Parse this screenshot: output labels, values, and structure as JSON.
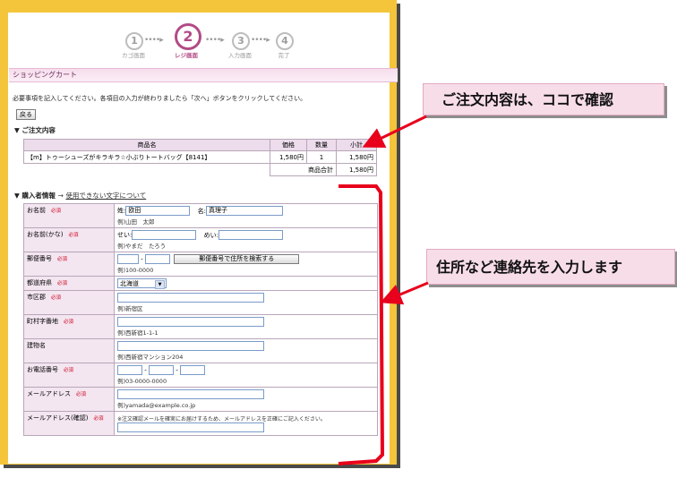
{
  "steps": [
    {
      "num": "①",
      "label": "カゴ画面",
      "active": false
    },
    {
      "num": "②",
      "label": "レジ画面",
      "active": true
    },
    {
      "num": "③",
      "label": "入力画面",
      "active": false
    },
    {
      "num": "④",
      "label": "完了",
      "active": false
    }
  ],
  "step_arrows": "••••▸",
  "section_title": "ショッピングカート",
  "instruction": "必要事項を記入してください。各項目の入力が終わりましたら「次へ」ボタンをクリックしてください。",
  "back_button": "戻る",
  "order": {
    "heading": "▼ ご注文内容",
    "headers": [
      "商品名",
      "価格",
      "数量",
      "小計"
    ],
    "row": {
      "name": "【m】トゥーシューズがキラキラ☆小ぶりトートバッグ【8141】",
      "price": "1,580円",
      "qty": "1",
      "subtotal": "1,580円"
    },
    "total_label": "商品合計",
    "total_value": "1,580円"
  },
  "buyer": {
    "heading": "▼ 購入者情報",
    "arrow": "→",
    "link": "使用できない文字について",
    "required": "必須",
    "name": {
      "label": "お名前",
      "sei_label": "姓:",
      "sei_value": "欧田",
      "mei_label": "名:",
      "mei_value": "真理子",
      "example": "例)山田　太郎"
    },
    "kana": {
      "label": "お名前(かな)",
      "sei_label": "せい:",
      "mei_label": "めい:",
      "example": "例)やまだ　たろう"
    },
    "zip": {
      "label": "郵便番号",
      "dash": "-",
      "search_button": "郵便番号で住所を検索する",
      "example": "例)100-0000"
    },
    "pref": {
      "label": "都道府県",
      "value": "北海道"
    },
    "city": {
      "label": "市区郡",
      "example": "例)新宿区"
    },
    "town": {
      "label": "町村字番地",
      "example": "例)西新宿1-1-1"
    },
    "building": {
      "label": "建物名",
      "example": "例)西新宿マンション204"
    },
    "tel": {
      "label": "お電話番号",
      "dash": "-",
      "example": "例)03-0000-0000"
    },
    "email": {
      "label": "メールアドレス",
      "example": "例)yamada@example.co.jp"
    },
    "email_confirm": {
      "label": "メールアドレス(確認)",
      "note": "※注文確認メールを確実にお届けするため、メールアドレスを正確にご記入ください。"
    }
  },
  "callouts": {
    "order": "ご注文内容は、ココで確認",
    "address": "住所など連絡先を入力します"
  },
  "colors": {
    "frame": "#f4c53a",
    "accent": "#b24b86",
    "callout_bg": "#f7dde8",
    "annotation_red": "#e8001c"
  }
}
